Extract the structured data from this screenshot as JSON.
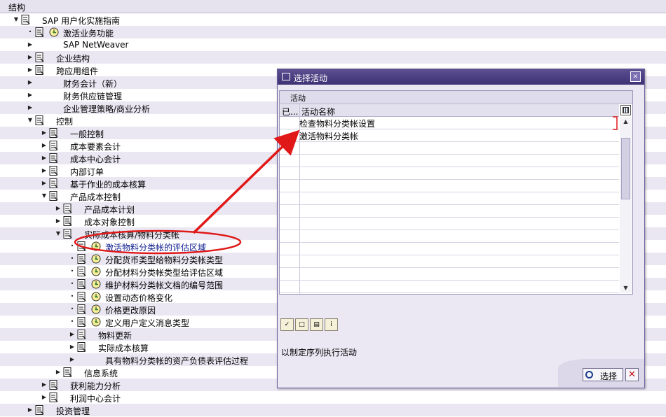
{
  "header": {
    "title": "结构"
  },
  "tree": {
    "rows": [
      {
        "label": "SAP 用户化实施指南",
        "expand": "open",
        "doc": true,
        "clock": false,
        "indent": 0
      },
      {
        "label": "激活业务功能",
        "expand": "leaf",
        "doc": true,
        "clock": true,
        "indent": 1
      },
      {
        "label": "SAP NetWeaver",
        "expand": "closed",
        "doc": false,
        "clock": false,
        "indent": 1
      },
      {
        "label": "企业结构",
        "expand": "closed",
        "doc": true,
        "clock": false,
        "indent": 1
      },
      {
        "label": "跨应用组件",
        "expand": "closed",
        "doc": true,
        "clock": false,
        "indent": 1
      },
      {
        "label": "财务会计（新）",
        "expand": "closed",
        "doc": false,
        "clock": false,
        "indent": 1
      },
      {
        "label": "财务供应链管理",
        "expand": "closed",
        "doc": false,
        "clock": false,
        "indent": 1
      },
      {
        "label": "企业管理策略/商业分析",
        "expand": "closed",
        "doc": false,
        "clock": false,
        "indent": 1
      },
      {
        "label": "控制",
        "expand": "open",
        "doc": true,
        "clock": false,
        "indent": 1
      },
      {
        "label": "一般控制",
        "expand": "closed",
        "doc": true,
        "clock": false,
        "indent": 2
      },
      {
        "label": "成本要素会计",
        "expand": "closed",
        "doc": true,
        "clock": false,
        "indent": 2
      },
      {
        "label": "成本中心会计",
        "expand": "closed",
        "doc": true,
        "clock": false,
        "indent": 2
      },
      {
        "label": "内部订单",
        "expand": "closed",
        "doc": true,
        "clock": false,
        "indent": 2
      },
      {
        "label": "基于作业的成本核算",
        "expand": "closed",
        "doc": true,
        "clock": false,
        "indent": 2
      },
      {
        "label": "产品成本控制",
        "expand": "open",
        "doc": true,
        "clock": false,
        "indent": 2
      },
      {
        "label": "产品成本计划",
        "expand": "closed",
        "doc": true,
        "clock": false,
        "indent": 3
      },
      {
        "label": "成本对象控制",
        "expand": "closed",
        "doc": true,
        "clock": false,
        "indent": 3
      },
      {
        "label": "实际成本核算/物料分类帐",
        "expand": "open",
        "doc": true,
        "clock": false,
        "indent": 3
      },
      {
        "label": "激活物料分类帐的评估区域",
        "expand": "leaf",
        "doc": true,
        "clock": true,
        "indent": 4,
        "selected": true
      },
      {
        "label": "分配货币类型给物料分类帐类型",
        "expand": "leaf",
        "doc": true,
        "clock": true,
        "indent": 4
      },
      {
        "label": "分配材料分类帐类型给评估区域",
        "expand": "leaf",
        "doc": true,
        "clock": true,
        "indent": 4
      },
      {
        "label": "维护材料分类帐文档的编号范围",
        "expand": "leaf",
        "doc": true,
        "clock": true,
        "indent": 4
      },
      {
        "label": "设置动态价格变化",
        "expand": "leaf",
        "doc": true,
        "clock": true,
        "indent": 4
      },
      {
        "label": "价格更改原因",
        "expand": "leaf",
        "doc": true,
        "clock": true,
        "indent": 4
      },
      {
        "label": "定义用户定义消息类型",
        "expand": "leaf",
        "doc": true,
        "clock": true,
        "indent": 4
      },
      {
        "label": "物料更新",
        "expand": "closed",
        "doc": true,
        "clock": false,
        "indent": 4
      },
      {
        "label": "实际成本核算",
        "expand": "closed",
        "doc": true,
        "clock": false,
        "indent": 4
      },
      {
        "label": "具有物料分类帐的资产负债表评估过程",
        "expand": "closed",
        "doc": false,
        "clock": false,
        "indent": 4
      },
      {
        "label": "信息系统",
        "expand": "closed",
        "doc": true,
        "clock": false,
        "indent": 3
      },
      {
        "label": "获利能力分析",
        "expand": "closed",
        "doc": true,
        "clock": false,
        "indent": 2
      },
      {
        "label": "利润中心会计",
        "expand": "closed",
        "doc": true,
        "clock": false,
        "indent": 2
      },
      {
        "label": "投资管理",
        "expand": "closed",
        "doc": true,
        "clock": false,
        "indent": 1
      }
    ]
  },
  "dialog": {
    "title": "选择活动",
    "close_glyph": "×",
    "grid_caption": "活动",
    "col_done": "已...",
    "col_name": "活动名称",
    "rows": [
      "检查物料分类帐设置",
      "激活物料分类帐"
    ],
    "empty_rows": 12,
    "hint": "以制定序列执行活动",
    "ok_label": "选择",
    "cancel_glyph": "✕"
  },
  "colors": {
    "accent": "#e01818",
    "title_bar": "#4a3f84",
    "row_alt": "#eae7f2"
  }
}
